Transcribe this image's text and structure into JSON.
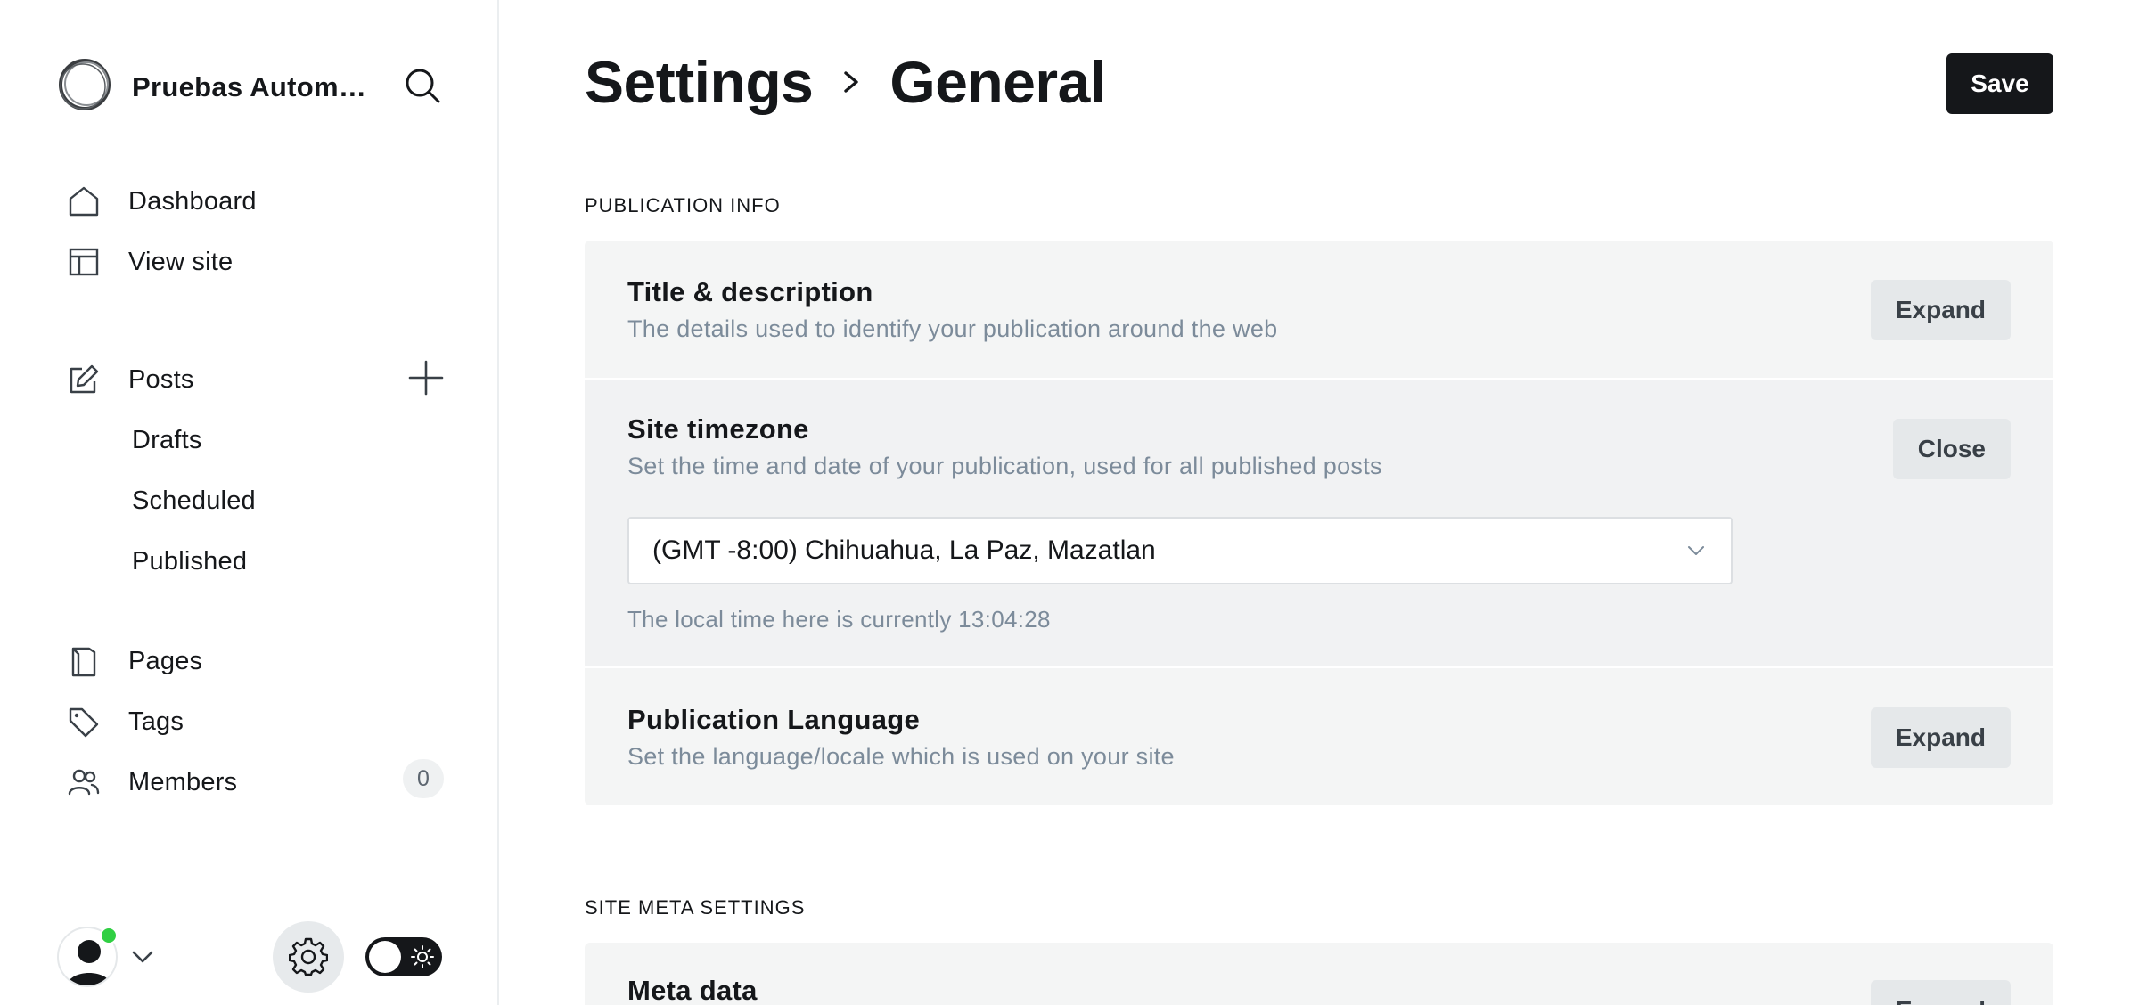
{
  "sidebar": {
    "site_name": "Pruebas Automa...",
    "nav": [
      {
        "label": "Dashboard",
        "icon": "home-icon"
      },
      {
        "label": "View site",
        "icon": "layout-icon"
      },
      {
        "label": "Posts",
        "icon": "edit-icon"
      },
      {
        "label": "Pages",
        "icon": "page-icon"
      },
      {
        "label": "Tags",
        "icon": "tag-icon"
      },
      {
        "label": "Members",
        "icon": "members-icon"
      }
    ],
    "posts_sub": [
      "Drafts",
      "Scheduled",
      "Published"
    ],
    "members_count": "0"
  },
  "header": {
    "breadcrumb_parent": "Settings",
    "breadcrumb_current": "General",
    "save_label": "Save"
  },
  "sections": {
    "publication_info": {
      "heading": "PUBLICATION INFO",
      "title_desc": {
        "title": "Title & description",
        "desc": "The details used to identify your publication around the web",
        "button": "Expand"
      },
      "timezone": {
        "title": "Site timezone",
        "desc": "Set the time and date of your publication, used for all published posts",
        "button": "Close",
        "selected": "(GMT -8:00) Chihuahua, La Paz, Mazatlan",
        "hint": "The local time here is currently 13:04:28"
      },
      "language": {
        "title": "Publication Language",
        "desc": "Set the language/locale which is used on your site",
        "button": "Expand"
      }
    },
    "site_meta": {
      "heading": "SITE META SETTINGS",
      "meta_data": {
        "title": "Meta data",
        "button": "Expand"
      }
    }
  },
  "colors": {
    "primary": "#15171a",
    "card_bg": "#f4f5f5",
    "muted_text": "#7c8b9a",
    "online": "#30cf43"
  }
}
